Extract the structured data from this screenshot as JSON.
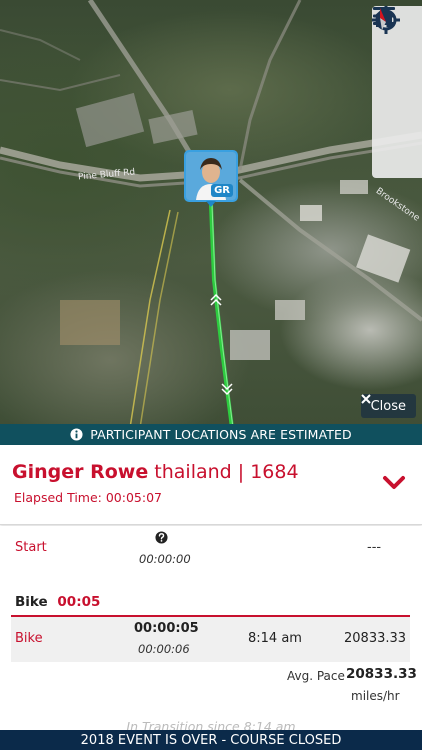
{
  "map": {
    "road_labels": [
      "Pine Bluff Rd",
      "Brookstone"
    ],
    "close_label": "Close",
    "toolbar": [
      "menu-icon",
      "home-icon",
      "crosshair-icon",
      "compass-icon"
    ],
    "participant_initials": "GR",
    "route_color": "#2ecc40"
  },
  "banner": {
    "text": "PARTICIPANT LOCATIONS ARE ESTIMATED",
    "icon": "info-icon"
  },
  "participant": {
    "name": "Ginger Rowe",
    "details": "thailand | 1684",
    "elapsed": "Elapsed Time: 00:05:07"
  },
  "splits": {
    "start": {
      "label": "Start",
      "time": "00:00:00",
      "value": "---"
    },
    "bike": {
      "section_label": "Bike",
      "section_time": "00:05",
      "row_label": "Bike",
      "split_time": "00:00:05",
      "split_time_sub": "00:00:06",
      "clock_time": "8:14 am",
      "distance": "20833.33",
      "pace_label": "Avg. Pace",
      "pace_value": "20833.33",
      "pace_unit": "miles/hr"
    },
    "transition_note": "In Transition since 8:14 am"
  },
  "footer": {
    "text": "2018 EVENT IS OVER - COURSE CLOSED"
  },
  "colors": {
    "accent": "#c8102e",
    "banner": "#10505e",
    "footer": "#0b2a4a"
  }
}
